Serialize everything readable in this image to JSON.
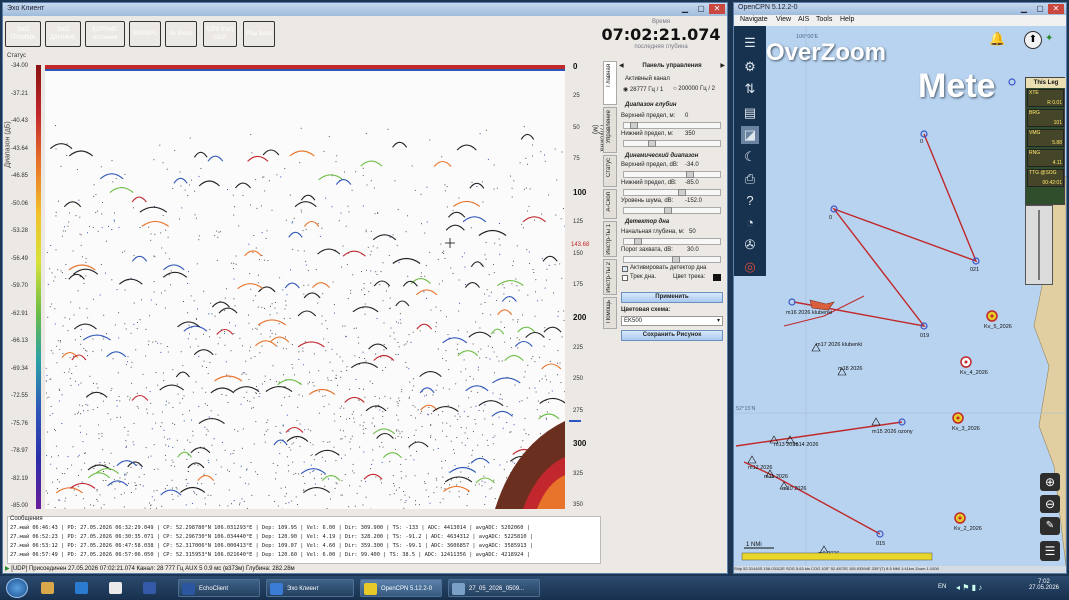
{
  "echo_window": {
    "title": "Эхо Клиент",
    "toolbar": [
      {
        "label": "ЭХО ГРАММА",
        "color": "#2a8a2a"
      },
      {
        "label": "ЭХО ДАННЫЕ",
        "color": "#2a8a2a"
      },
      {
        "label": "$GPRMC источник",
        "color": "#2a8a2a"
      },
      {
        "label": "$GPWPL",
        "color": "#c0282a"
      },
      {
        "label": "Sv Mode",
        "color": "#3b56c4"
      },
      {
        "label": "GPS from UDP",
        "color": "#7a7a7a"
      },
      {
        "label": "Play Back",
        "color": "#7a7a7a"
      }
    ],
    "time_caption": "Время",
    "time_value": "07:02:21.074",
    "time_sub": "последняя глубина",
    "status_label": "Статус",
    "left_axis_label": "Диапазон (дБ)",
    "left_axis_ticks": [
      "-34.00",
      "-37.21",
      "-40.43",
      "-43.64",
      "-46.85",
      "-50.06",
      "-53.28",
      "-56.49",
      "-59.70",
      "-62.91",
      "-66.13",
      "-69.34",
      "-72.55",
      "-75.76",
      "-78.97",
      "-82.19",
      "-85.00"
    ],
    "right_axis_label": "Глубина (м)",
    "right_axis_ticks": [
      {
        "label": "0",
        "bold": true
      },
      {
        "label": "25",
        "bold": false
      },
      {
        "label": "50",
        "bold": false
      },
      {
        "label": "75",
        "bold": false
      },
      {
        "label": "100",
        "bold": true
      },
      {
        "label": "125",
        "bold": false
      },
      {
        "label": "150",
        "bold": false
      },
      {
        "label": "175",
        "bold": false
      },
      {
        "label": "200",
        "bold": true
      },
      {
        "label": "225",
        "bold": false
      },
      {
        "label": "250",
        "bold": false
      },
      {
        "label": "275",
        "bold": false
      },
      {
        "label": "300",
        "bold": true
      },
      {
        "label": "325",
        "bold": false
      },
      {
        "label": "350",
        "bold": false
      }
    ],
    "depth_marker": "143.68",
    "tabs": [
      "Главная",
      "Управление",
      "Статус",
      "А-Скоп",
      "Инстр-ты 1",
      "Инстр-ты 2",
      "Помощь"
    ],
    "panel": {
      "title": "Панель управления",
      "active_channel": "Активный канал",
      "channel1": "28777 Гц / 1",
      "channel2": "200000 Гц / 2",
      "depth_range_head": "Диапазон глубин",
      "upper_limit_label": "Верхний предел, м:",
      "upper_limit_value": "0",
      "lower_limit_label": "Нижний предел, м:",
      "lower_limit_value": "350",
      "dyn_range_head": "Динамический диапазон",
      "upper_db_label": "Верхний предел, dB:",
      "upper_db_value": "-34.0",
      "lower_db_label": "Нижний предел, dB:",
      "lower_db_value": "-85.0",
      "noise_label": "Уровень шума, dB:",
      "noise_value": "-152.0",
      "bottom_head": "Детектор дна",
      "start_depth_label": "Начальная глубина, м:",
      "start_depth_value": "50",
      "threshold_label": "Порог захвата, dB:",
      "threshold_value": "30.0",
      "activate_label": "Активировать детектор дна",
      "track_label": "Трек дна.",
      "track_color_label": "Цвет трека:",
      "apply_button": "Применить",
      "scheme_label": "Цветовая схема:",
      "scheme_value": "EK500",
      "save_button": "Сохранить Рисунок"
    },
    "messages_title": "Сообщения",
    "messages": [
      "27.май 06:46:43 | PD: 27.05.2026 06:32:29.049 | CP: 52.298780°N 106.031293°E | Dep: 109.95 | Vel: 6.00 | Dir: 309.900 | TS: -133 | ADC: 4413014 | avgADC: 5202060 |",
      "27.май 06:52:23 | PD: 27.05.2026 06:30:35.071 | CP: 52.296730°N 106.034440°E | Dep: 120.90 | Vel: 4.19 | Dir: 328.200 | TS: -91.2 | ADC: 4634312 | avgADC: 5225810 |",
      "27.май 06:53:12 | PD: 27.05.2026 06:47:58.038 | CP: 52.317006°N 106.000413°E | Dep: 109.07 | Vel: 4.60 | Dir: 359.300 | TS: -99.1 | ADC: 3606857 | avgADC: 3585913 |",
      "27.май 06:57:49 | PD: 27.05.2026 06:57:06.050 | CP: 52.315953°N 106.021640°E | Dep: 120.60 | Vel: 6.00 | Dir: 99.400 | TS: 38.5 | ADC: 12411356 | avgADC: 4218924 |"
    ],
    "statusbar": "[UDP] Присоединен   27.05.2026   07:02:21.074   Канал: 28 777 Гц   AUX 5   0.9 мс   (в373м)   Глубина: 282.28м"
  },
  "cpn_window": {
    "title": "OpenCPN 5.12.2-0",
    "menu": [
      "Navigate",
      "View",
      "AIS",
      "Tools",
      "Help"
    ],
    "overzoom": "OverZoom",
    "mete": "Mete",
    "this_leg": {
      "title": "This Leg",
      "rows": [
        {
          "label": "XTE",
          "value": "R 0.01"
        },
        {
          "label": "BRG",
          "value": "101"
        },
        {
          "label": "VMG",
          "value": "5.88"
        },
        {
          "label": "RNG",
          "value": "4.11"
        },
        {
          "label": "TTG @SOG",
          "value": "00:42:01"
        }
      ]
    },
    "grid_labels": [
      "106°00'E",
      "52°15'N"
    ],
    "waypoints": [
      "0",
      "0",
      "021",
      "019",
      "m16 2026 klubenki",
      "m17 2026 klubenki",
      "m18 2026",
      "m15 2026 ozony",
      "m12 2026",
      "m11 2026",
      "m10 2026",
      "m13 2026",
      "m14 2026",
      "m9 2026",
      "015",
      "Kv_5_2026",
      "Kv_4_2026",
      "Kv_3_2026",
      "Kv_2_2026"
    ],
    "scale": "1 NMi",
    "statusbar": "Ship 52.31440S 106.03112E   SOG 5.63 kts  COG 105°   52.4873S 105.93394E   339°(T) 8.5 NMi 1:41km   Zoom 1:1000"
  },
  "taskbar": {
    "items": [
      "",
      "",
      "",
      "",
      "EchoClient",
      "Эхо Клиент",
      "OpenCPN 5.12.2-0",
      "27_05_2026_0509..."
    ],
    "lang": "EN",
    "clock_time": "7:02",
    "clock_date": "27.05.2026"
  },
  "colors": {
    "echo_bg": "#fbfbfb",
    "route_red": "#c0282a",
    "waypoint_blue": "#3a56c4",
    "chart_water": "#b8d3ef",
    "land": "#e2cfa1"
  }
}
